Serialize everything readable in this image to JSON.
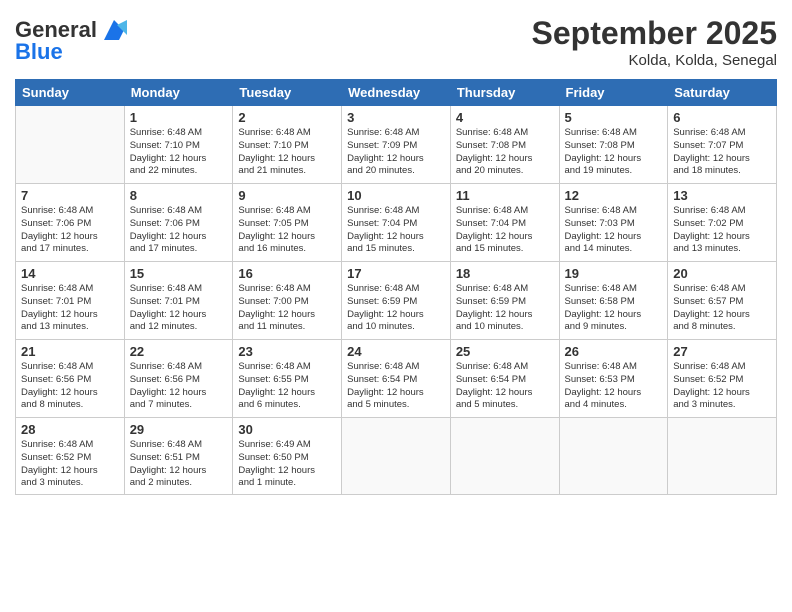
{
  "logo": {
    "line1": "General",
    "line2": "Blue"
  },
  "title": "September 2025",
  "subtitle": "Kolda, Kolda, Senegal",
  "days_of_week": [
    "Sunday",
    "Monday",
    "Tuesday",
    "Wednesday",
    "Thursday",
    "Friday",
    "Saturday"
  ],
  "weeks": [
    [
      {
        "day": "",
        "info": ""
      },
      {
        "day": "1",
        "info": "Sunrise: 6:48 AM\nSunset: 7:10 PM\nDaylight: 12 hours\nand 22 minutes."
      },
      {
        "day": "2",
        "info": "Sunrise: 6:48 AM\nSunset: 7:10 PM\nDaylight: 12 hours\nand 21 minutes."
      },
      {
        "day": "3",
        "info": "Sunrise: 6:48 AM\nSunset: 7:09 PM\nDaylight: 12 hours\nand 20 minutes."
      },
      {
        "day": "4",
        "info": "Sunrise: 6:48 AM\nSunset: 7:08 PM\nDaylight: 12 hours\nand 20 minutes."
      },
      {
        "day": "5",
        "info": "Sunrise: 6:48 AM\nSunset: 7:08 PM\nDaylight: 12 hours\nand 19 minutes."
      },
      {
        "day": "6",
        "info": "Sunrise: 6:48 AM\nSunset: 7:07 PM\nDaylight: 12 hours\nand 18 minutes."
      }
    ],
    [
      {
        "day": "7",
        "info": "Sunrise: 6:48 AM\nSunset: 7:06 PM\nDaylight: 12 hours\nand 17 minutes."
      },
      {
        "day": "8",
        "info": "Sunrise: 6:48 AM\nSunset: 7:06 PM\nDaylight: 12 hours\nand 17 minutes."
      },
      {
        "day": "9",
        "info": "Sunrise: 6:48 AM\nSunset: 7:05 PM\nDaylight: 12 hours\nand 16 minutes."
      },
      {
        "day": "10",
        "info": "Sunrise: 6:48 AM\nSunset: 7:04 PM\nDaylight: 12 hours\nand 15 minutes."
      },
      {
        "day": "11",
        "info": "Sunrise: 6:48 AM\nSunset: 7:04 PM\nDaylight: 12 hours\nand 15 minutes."
      },
      {
        "day": "12",
        "info": "Sunrise: 6:48 AM\nSunset: 7:03 PM\nDaylight: 12 hours\nand 14 minutes."
      },
      {
        "day": "13",
        "info": "Sunrise: 6:48 AM\nSunset: 7:02 PM\nDaylight: 12 hours\nand 13 minutes."
      }
    ],
    [
      {
        "day": "14",
        "info": "Sunrise: 6:48 AM\nSunset: 7:01 PM\nDaylight: 12 hours\nand 13 minutes."
      },
      {
        "day": "15",
        "info": "Sunrise: 6:48 AM\nSunset: 7:01 PM\nDaylight: 12 hours\nand 12 minutes."
      },
      {
        "day": "16",
        "info": "Sunrise: 6:48 AM\nSunset: 7:00 PM\nDaylight: 12 hours\nand 11 minutes."
      },
      {
        "day": "17",
        "info": "Sunrise: 6:48 AM\nSunset: 6:59 PM\nDaylight: 12 hours\nand 10 minutes."
      },
      {
        "day": "18",
        "info": "Sunrise: 6:48 AM\nSunset: 6:59 PM\nDaylight: 12 hours\nand 10 minutes."
      },
      {
        "day": "19",
        "info": "Sunrise: 6:48 AM\nSunset: 6:58 PM\nDaylight: 12 hours\nand 9 minutes."
      },
      {
        "day": "20",
        "info": "Sunrise: 6:48 AM\nSunset: 6:57 PM\nDaylight: 12 hours\nand 8 minutes."
      }
    ],
    [
      {
        "day": "21",
        "info": "Sunrise: 6:48 AM\nSunset: 6:56 PM\nDaylight: 12 hours\nand 8 minutes."
      },
      {
        "day": "22",
        "info": "Sunrise: 6:48 AM\nSunset: 6:56 PM\nDaylight: 12 hours\nand 7 minutes."
      },
      {
        "day": "23",
        "info": "Sunrise: 6:48 AM\nSunset: 6:55 PM\nDaylight: 12 hours\nand 6 minutes."
      },
      {
        "day": "24",
        "info": "Sunrise: 6:48 AM\nSunset: 6:54 PM\nDaylight: 12 hours\nand 5 minutes."
      },
      {
        "day": "25",
        "info": "Sunrise: 6:48 AM\nSunset: 6:54 PM\nDaylight: 12 hours\nand 5 minutes."
      },
      {
        "day": "26",
        "info": "Sunrise: 6:48 AM\nSunset: 6:53 PM\nDaylight: 12 hours\nand 4 minutes."
      },
      {
        "day": "27",
        "info": "Sunrise: 6:48 AM\nSunset: 6:52 PM\nDaylight: 12 hours\nand 3 minutes."
      }
    ],
    [
      {
        "day": "28",
        "info": "Sunrise: 6:48 AM\nSunset: 6:52 PM\nDaylight: 12 hours\nand 3 minutes."
      },
      {
        "day": "29",
        "info": "Sunrise: 6:48 AM\nSunset: 6:51 PM\nDaylight: 12 hours\nand 2 minutes."
      },
      {
        "day": "30",
        "info": "Sunrise: 6:49 AM\nSunset: 6:50 PM\nDaylight: 12 hours\nand 1 minute."
      },
      {
        "day": "",
        "info": ""
      },
      {
        "day": "",
        "info": ""
      },
      {
        "day": "",
        "info": ""
      },
      {
        "day": "",
        "info": ""
      }
    ]
  ]
}
